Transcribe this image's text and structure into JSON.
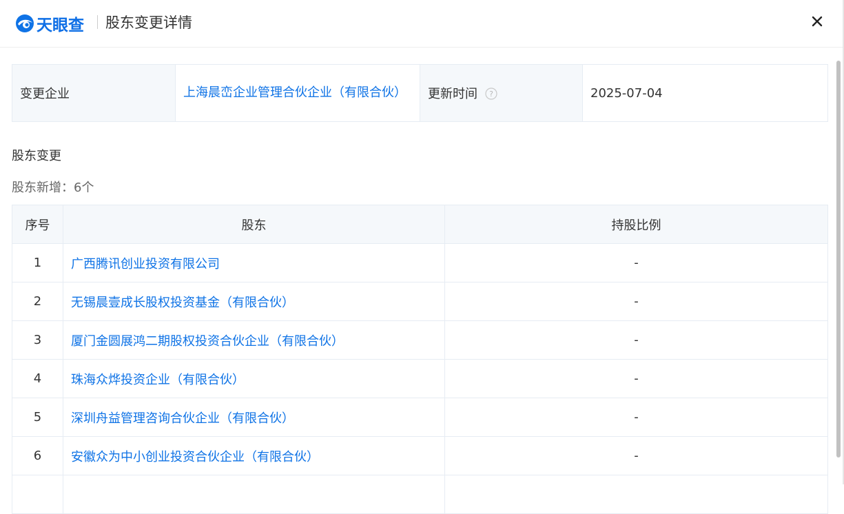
{
  "header": {
    "logo_text": "天眼查",
    "title": "股东变更详情",
    "brand_color": "#0f73e6"
  },
  "info": {
    "company_label": "变更企业",
    "company_value": "上海晨峦企业管理合伙企业（有限合伙）",
    "update_label": "更新时间",
    "update_value": "2025-07-04"
  },
  "section": {
    "title": "股东变更",
    "subtitle": "股东新增：6个"
  },
  "table": {
    "headers": [
      "序号",
      "股东",
      "持股比例"
    ],
    "rows": [
      {
        "idx": "1",
        "name": "广西腾讯创业投资有限公司",
        "ratio": "-"
      },
      {
        "idx": "2",
        "name": "无锡晨壹成长股权投资基金（有限合伙）",
        "ratio": "-"
      },
      {
        "idx": "3",
        "name": "厦门金圆展鸿二期股权投资合伙企业（有限合伙）",
        "ratio": "-"
      },
      {
        "idx": "4",
        "name": "珠海众烨投资企业（有限合伙）",
        "ratio": "-"
      },
      {
        "idx": "5",
        "name": "深圳舟益管理咨询合伙企业（有限合伙）",
        "ratio": "-"
      },
      {
        "idx": "6",
        "name": "安徽众为中小创业投资合伙企业（有限合伙）",
        "ratio": "-"
      }
    ]
  }
}
